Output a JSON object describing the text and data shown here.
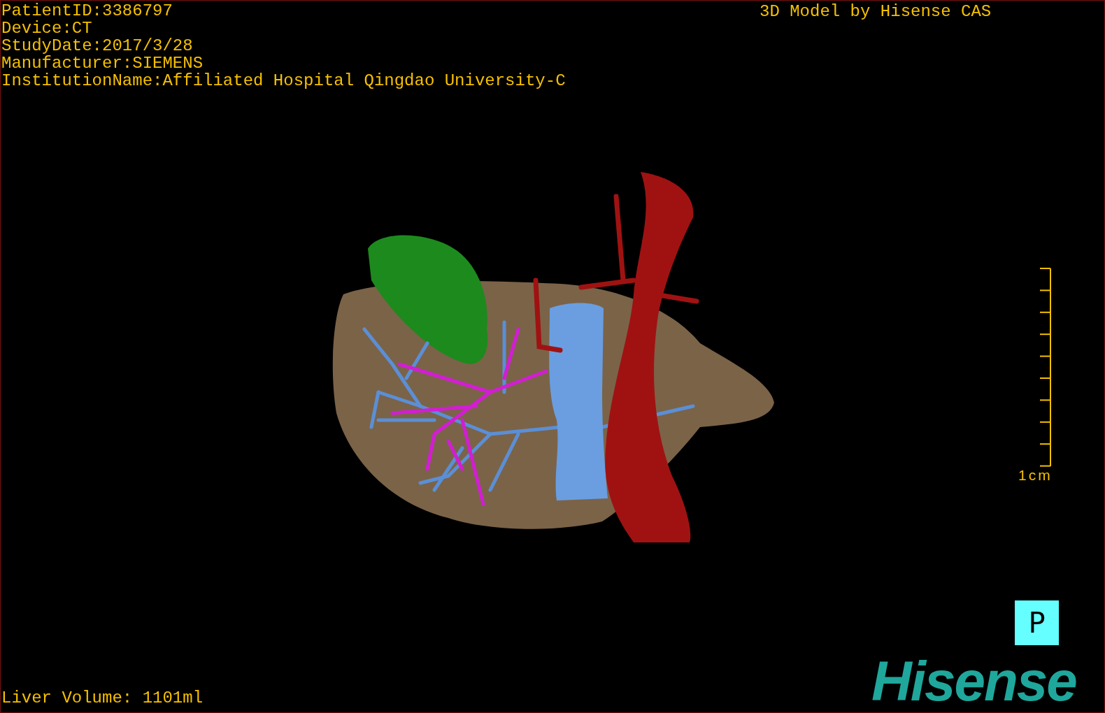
{
  "patient_info": [
    "PatientID:3386797",
    "Device:CT",
    "StudyDate:2017/3/28",
    "Manufacturer:SIEMENS",
    "InstitutionName:Affiliated Hospital Qingdao University-C"
  ],
  "model_credit": "3D Model by Hisense CAS",
  "scale_bar": {
    "label": "1cm"
  },
  "orientation_marker": "P",
  "logo": "Hisense",
  "liver_volume": "Liver Volume: 1101ml"
}
